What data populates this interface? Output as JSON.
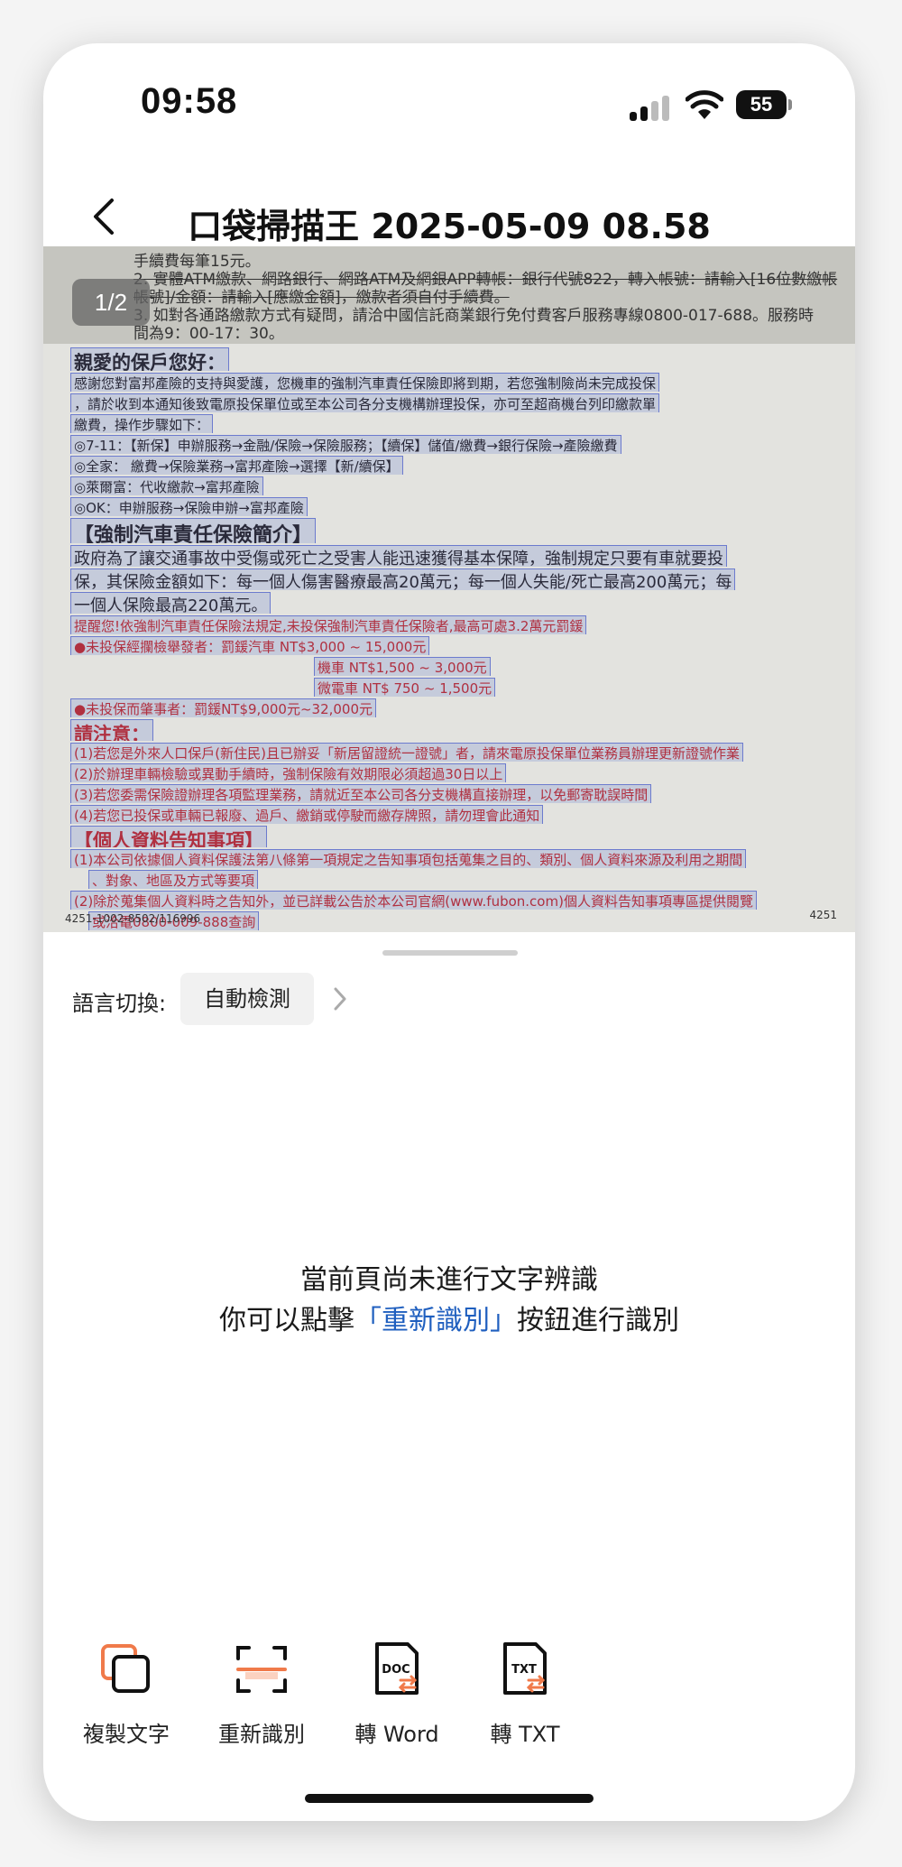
{
  "status_bar": {
    "time": "09:58",
    "battery": "55"
  },
  "header": {
    "title": "口袋掃描王 2025-05-09 08.58"
  },
  "document": {
    "page_indicator": "1/2",
    "top_lines": [
      "手續費每筆15元。",
      "2.  實體ATM繳款、網路銀行、網路ATM及網銀APP轉帳：銀行代號822，轉入帳號：請輸入[16位數繳帳",
      "     帳號]/金額：請輸入[應繳金額]，繳款者須自付手續費。",
      "3.  如對各通路繳款方式有疑問，請洽中國信託商業銀行免付費客戶服務專線0800-017-688。服務時",
      "     間為9：00-17：30。"
    ],
    "lines": [
      "親愛的保戶您好：",
      "感謝您對富邦產險的支持與愛護，您機車的強制汽車責任保險即將到期，若您強制險尚未完成投保",
      "，請於收到本通知後致電原投保單位或至本公司各分支機構辦理投保，亦可至超商機台列印繳款單",
      "繳費，操作步驟如下：",
      "◎7-11：【新保】申辦服務→金融/保險→保險服務；【續保】儲值/繳費→銀行保險→產險繳費",
      "◎全家： 繳費→保險業務→富邦產險→選擇【新/續保】",
      "◎萊爾富：代收繳款→富邦產險",
      "◎OK：申辦服務→保險申辦→富邦產險",
      "【強制汽車責任保險簡介】",
      "政府為了讓交通事故中受傷或死亡之受害人能迅速獲得基本保障，強制規定只要有車就要投",
      "保，其保險金額如下：每一個人傷害醫療最高20萬元；每一個人失能/死亡最高200萬元；每",
      "一個人保險最高220萬元。",
      "提醒您!依強制汽車責任保險法規定,未投保強制汽車責任保險者,最高可處3.2萬元罰鍰",
      "●未投保經攔檢舉發者：罰鍰汽車    NT$3,000 ~ 15,000元",
      "機車    NT$1,500 ~  3,000元",
      "微電車  NT$    750 ~  1,500元",
      "●未投保而肇事者：罰鍰NT$9,000元~32,000元",
      "請注意：",
      "(1)若您是外來人口保戶(新住民)且已辦妥「新居留證統一證號」者，請來電原投保單位業務員辦理更新證號作業",
      "(2)於辦理車輛檢驗或異動手續時，強制保險有效期限必須超過30日以上",
      "(3)若您委需保險證辦理各項監理業務，請就近至本公司各分支機構直接辦理，以免郵寄耽誤時間",
      "(4)若您已投保或車輛已報廢、過戶、繳銷或停駛而繳存牌照，請勿理會此通知",
      "【個人資料告知事項】",
      "(1)本公司依據個人資料保護法第八條第一項規定之告知事項包括蒐集之目的、類別、個人資料來源及利用之期間",
      "、對象、地區及方式等要項",
      "(2)除於蒐集個人資料時之告知外，並已詳載公告於本公司官網(www.fubon.com)個人資料告知事項專區提供閱覽",
      "或洽電0800-009-888查詢"
    ],
    "footer_left": "4251-1002-8502/116996",
    "footer_right": "4251"
  },
  "language": {
    "label": "語言切換:",
    "value": "自動檢測"
  },
  "empty_state": {
    "line1": "當前頁尚未進行文字辨識",
    "line2_prefix": "你可以點擊",
    "line2_link": "「重新識別」",
    "line2_suffix": "按鈕進行識別"
  },
  "toolbar": {
    "copy": "複製文字",
    "rescan": "重新識別",
    "to_word": "轉 Word",
    "to_txt": "轉 TXT",
    "doc_badge": "DOC",
    "txt_badge": "TXT"
  },
  "colors": {
    "accent": "#1f5fbf",
    "icon_orange": "#f07a4a"
  }
}
